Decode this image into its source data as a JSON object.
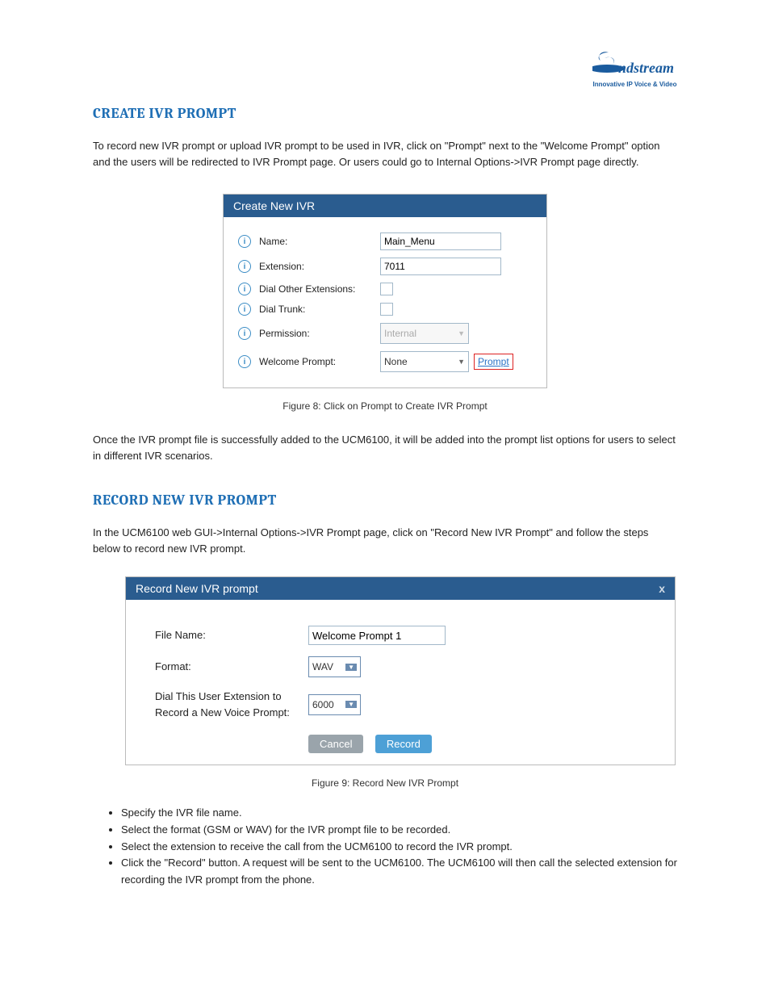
{
  "logo": {
    "brand": "ndstream",
    "tagline": "Innovative IP Voice & Video"
  },
  "section1": {
    "title": "CREATE IVR PROMPT",
    "intro": "To record new IVR prompt or upload IVR prompt to be used in IVR, click on \"Prompt\" next to the \"Welcome Prompt\" option and the users will be redirected to IVR Prompt page. Or users could go to Internal Options->IVR Prompt page directly.",
    "panel": {
      "header": "Create New IVR",
      "rows": {
        "name_label": "Name:",
        "name_value": "Main_Menu",
        "extension_label": "Extension:",
        "extension_value": "7011",
        "dial_other_label": "Dial Other Extensions:",
        "dial_trunk_label": "Dial Trunk:",
        "permission_label": "Permission:",
        "permission_value": "Internal",
        "welcome_label": "Welcome Prompt:",
        "welcome_value": "None",
        "prompt_link": "Prompt"
      }
    },
    "caption": "Figure 8: Click on Prompt to Create IVR Prompt",
    "outro": "Once the IVR prompt file is successfully added to the UCM6100, it will be added into the prompt list options for users to select in different IVR scenarios."
  },
  "section2": {
    "title": "RECORD NEW IVR PROMPT",
    "intro": "In the UCM6100 web GUI->Internal Options->IVR Prompt page, click on \"Record New IVR Prompt\" and follow the steps below to record new IVR prompt.",
    "panel": {
      "header": "Record New IVR prompt",
      "rows": {
        "file_name_label": "File Name:",
        "file_name_value": "Welcome Prompt 1",
        "format_label": "Format:",
        "format_value": "WAV",
        "dial_ext_label": "Dial This User Extension to Record a New Voice Prompt:",
        "dial_ext_value": "6000"
      },
      "cancel": "Cancel",
      "record": "Record"
    },
    "caption": "Figure 9: Record New IVR Prompt",
    "bullets": [
      "Specify the IVR file name.",
      "Select the format (GSM or WAV) for the IVR prompt file to be recorded.",
      "Select the extension to receive the call from the UCM6100 to record the IVR prompt.",
      "Click the \"Record\" button. A request will be sent to the UCM6100. The UCM6100 will then call the selected extension for recording the IVR prompt from the phone."
    ]
  }
}
